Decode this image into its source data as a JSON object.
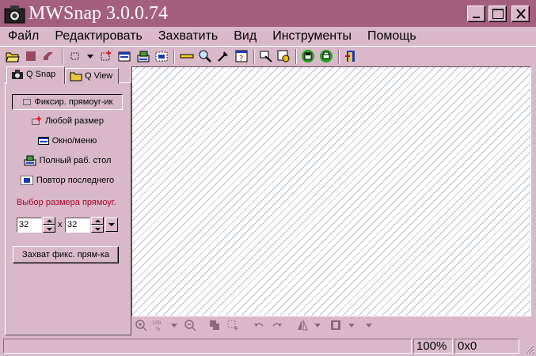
{
  "window": {
    "title": "MWSnap 3.0.0.74",
    "controls": [
      "minimize",
      "maximize",
      "close"
    ]
  },
  "menu": [
    "Файл",
    "Редактировать",
    "Захватить",
    "Вид",
    "Инструменты",
    "Помощь"
  ],
  "toolbar_icons": [
    "open-folder-icon",
    "stop-icon",
    "eraser-icon",
    "select-rect-icon",
    "dropdown-arrow-icon",
    "any-size-icon",
    "window-icon",
    "desktop-icon",
    "repeat-last-icon",
    "ruler-icon",
    "magnifier-icon",
    "color-picker-icon",
    "help-icon",
    "settings-icon",
    "image-settings-icon",
    "save-icon",
    "print-icon",
    "exit-icon"
  ],
  "tabs": [
    {
      "label": "Q Snap",
      "icon": "camera-icon",
      "active": true
    },
    {
      "label": "Q View",
      "icon": "folder-icon",
      "active": false
    }
  ],
  "capture_buttons": [
    {
      "label": "Фиксир. прямоуг-ик",
      "icon": "fixed-rect-icon",
      "active": true
    },
    {
      "label": "Любой размер",
      "icon": "any-size-icon",
      "active": false
    },
    {
      "label": "Окно/меню",
      "icon": "window-icon",
      "active": false
    },
    {
      "label": "Полный раб. стол",
      "icon": "desktop-icon",
      "active": false
    },
    {
      "label": "Повтор последнего",
      "icon": "repeat-last-icon",
      "active": false
    }
  ],
  "size_select": {
    "label": "Выбор размера прямоуг.",
    "width": "32",
    "separator": "x",
    "height": "32"
  },
  "capture_fixed_button": "Захват фикс. прям-ка",
  "image_toolbar_icons": [
    "zoom-in-icon",
    "zoom-100-icon",
    "dropdown-arrow-icon",
    "zoom-out-icon",
    "copy-icon",
    "crop-icon",
    "undo-icon",
    "redo-icon",
    "flip-icon",
    "dropdown-arrow-icon",
    "frame-icon",
    "dropdown-arrow-icon",
    "dropdown-arrow-icon"
  ],
  "status": {
    "zoom": "100%",
    "color": "0x0"
  },
  "colors": {
    "title_bar": "#a45f7e",
    "face": "#d9b9c9",
    "size_label": "#b4002c",
    "hatch": "#b9bfd4"
  }
}
